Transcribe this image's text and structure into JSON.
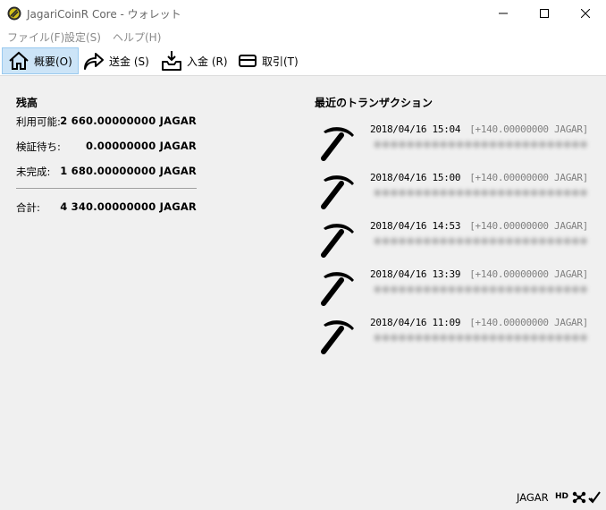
{
  "window": {
    "title": "JagariCoinR Core - ウォレット",
    "app_icon": "jagaricoin-logo-icon",
    "controls": [
      "minimize-icon",
      "maximize-icon",
      "close-icon"
    ]
  },
  "menu": {
    "items": [
      {
        "label": "ファイル(F)"
      },
      {
        "label": "設定(S)"
      },
      {
        "label": "ヘルプ(H)"
      }
    ]
  },
  "toolbar": {
    "items": [
      {
        "label": "概要(O)",
        "icon": "home-icon",
        "active": true
      },
      {
        "label": "送金 (S)",
        "icon": "send-arrow-icon",
        "active": false
      },
      {
        "label": "入金 (R)",
        "icon": "receive-inbox-icon",
        "active": false
      },
      {
        "label": "取引(T)",
        "icon": "transactions-card-icon",
        "active": false
      }
    ]
  },
  "balances": {
    "title": "残高",
    "available_label": "利用可能:",
    "available_value": "2 660.00000000 JAGAR",
    "pending_label": "検証待ち:",
    "pending_value": "0.00000000 JAGAR",
    "immature_label": "未完成:",
    "immature_value": "1 680.00000000 JAGAR",
    "total_label": "合計:",
    "total_value": "4 340.00000000 JAGAR"
  },
  "recent_transactions": {
    "title": "最近のトランザクション",
    "items": [
      {
        "date": "2018/04/16 15:04",
        "amount": "[+140.00000000 JAGAR]",
        "icon": "pickaxe-mined-icon"
      },
      {
        "date": "2018/04/16 15:00",
        "amount": "[+140.00000000 JAGAR]",
        "icon": "pickaxe-mined-icon"
      },
      {
        "date": "2018/04/16 14:53",
        "amount": "[+140.00000000 JAGAR]",
        "icon": "pickaxe-mined-icon"
      },
      {
        "date": "2018/04/16 13:39",
        "amount": "[+140.00000000 JAGAR]",
        "icon": "pickaxe-mined-icon"
      },
      {
        "date": "2018/04/16 11:09",
        "amount": "[+140.00000000 JAGAR]",
        "icon": "pickaxe-mined-icon"
      }
    ]
  },
  "status": {
    "unit": "JAGAR",
    "hd": "HD",
    "icons": [
      "network-connections-icon",
      "sync-check-icon"
    ]
  }
}
